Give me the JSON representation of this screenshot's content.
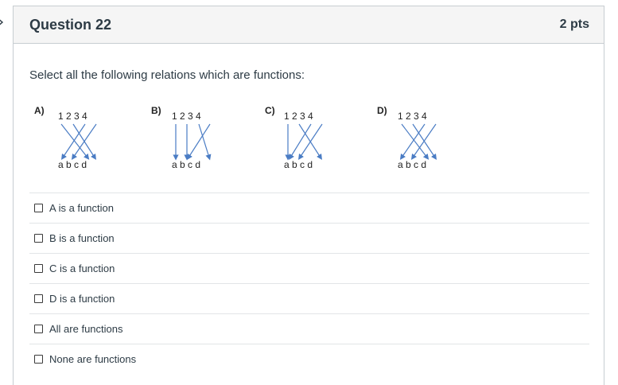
{
  "question": {
    "title": "Question 22",
    "points": "2 pts",
    "prompt": "Select all the following relations which are functions:"
  },
  "diagrams": [
    {
      "label": "A)",
      "domain": "1 2 3 4",
      "codomain": "a b c d"
    },
    {
      "label": "B)",
      "domain": "1 2 3 4",
      "codomain": "a b c d"
    },
    {
      "label": "C)",
      "domain": "1 2 3 4",
      "codomain": "a b c d"
    },
    {
      "label": "D)",
      "domain": "1 2 3 4",
      "codomain": "a b c d"
    }
  ],
  "answers": [
    {
      "label": "A is a function",
      "checked": false
    },
    {
      "label": "B is a function",
      "checked": false
    },
    {
      "label": "C is a function",
      "checked": false
    },
    {
      "label": "D is a function",
      "checked": false
    },
    {
      "label": "All are functions",
      "checked": false
    },
    {
      "label": "None are functions",
      "checked": false
    }
  ],
  "colors": {
    "arrow": "#4a7cc4",
    "border": "#c7cdd1",
    "header_bg": "#f5f5f5",
    "text": "#2d3b45"
  }
}
